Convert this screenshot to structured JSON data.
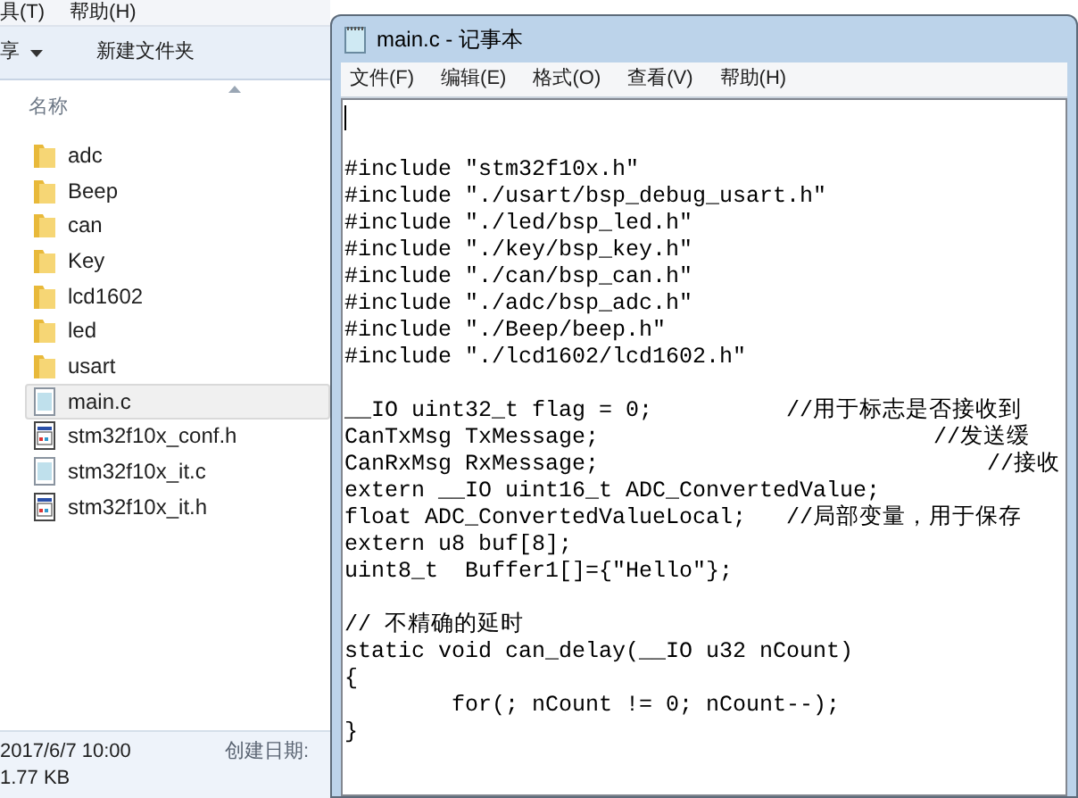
{
  "explorer": {
    "menu": [
      "具(T)",
      "帮助(H)"
    ],
    "toolbar": {
      "share": "享",
      "new_folder": "新建文件夹"
    },
    "column_header": "名称",
    "files": [
      {
        "name": "adc",
        "kind": "folder",
        "selected": false
      },
      {
        "name": "Beep",
        "kind": "folder",
        "selected": false
      },
      {
        "name": "can",
        "kind": "folder",
        "selected": false
      },
      {
        "name": "Key",
        "kind": "folder",
        "selected": false
      },
      {
        "name": "lcd1602",
        "kind": "folder",
        "selected": false
      },
      {
        "name": "led",
        "kind": "folder",
        "selected": false
      },
      {
        "name": "usart",
        "kind": "folder",
        "selected": false
      },
      {
        "name": "main.c",
        "kind": "c-file",
        "selected": true
      },
      {
        "name": "stm32f10x_conf.h",
        "kind": "h-file",
        "selected": false
      },
      {
        "name": "stm32f10x_it.c",
        "kind": "c-file",
        "selected": false
      },
      {
        "name": "stm32f10x_it.h",
        "kind": "h-file",
        "selected": false
      }
    ],
    "details": {
      "modified": "2017/6/7 10:00",
      "created_label": "创建日期:",
      "size": "1.77 KB"
    }
  },
  "notepad": {
    "title": "main.c - 记事本",
    "menu": [
      "文件(F)",
      "编辑(E)",
      "格式(O)",
      "查看(V)",
      "帮助(H)"
    ],
    "blocks": [
      [
        "#include \"stm32f10x.h\"",
        "#include \"./usart/bsp_debug_usart.h\"",
        "#include \"./led/bsp_led.h\"",
        "#include \"./key/bsp_key.h\"",
        "#include \"./can/bsp_can.h\"",
        "#include \"./adc/bsp_adc.h\"",
        "#include \"./Beep/beep.h\"",
        "#include \"./lcd1602/lcd1602.h\""
      ],
      [
        "__IO uint32_t flag = 0;          //用于标志是否接收到",
        "CanTxMsg TxMessage;                         //发送缓",
        "CanRxMsg RxMessage;                             //接收",
        "extern __IO uint16_t ADC_ConvertedValue;",
        "float ADC_ConvertedValueLocal;   //局部变量，用于保存",
        "extern u8 buf[8];",
        "uint8_t  Buffer1[]={\"Hello\"};"
      ],
      [
        "// 不精确的延时",
        "static void can_delay(__IO u32 nCount)",
        "{",
        "        for(; nCount != 0; nCount--);",
        "}"
      ]
    ]
  }
}
